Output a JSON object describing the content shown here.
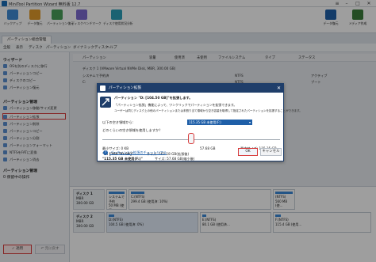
{
  "window": {
    "title": "MiniTool Partition Wizard 無料版 12.7"
  },
  "toolbar": {
    "items": [
      "バックアップ",
      "データ復元",
      "パーティション復元",
      "ディスクベンチマーク",
      "ディスク使用状況分析"
    ],
    "right_items": [
      "データ復元",
      "メディア作成"
    ]
  },
  "tabs": {
    "main": "パーティション総合管理"
  },
  "menu": [
    "全般",
    "表示",
    "ディスク",
    "パーティション",
    "ダイナミックディスク",
    "ヘルプ"
  ],
  "sidebar": {
    "wizard_header": "ウィザード",
    "wizard_items": [
      "OSを別のディスクに移行",
      "パーティションコピー",
      "ディスクのコピー",
      "パーティション復元"
    ],
    "partition_header": "パーティション管理",
    "partition_items": [
      "パーティション移動/サイズ変更",
      "パーティション拡張",
      "パーティション削除",
      "パーティションコピー",
      "パーティション分割",
      "パーティションフォーマット",
      "NTFSをFATに変換",
      "パーティション消去"
    ],
    "ops_header": "パーティション管理",
    "ops_status": "0 保留中の操作",
    "apply": "✓ 適用",
    "undo": "↶ 元に戻す"
  },
  "table": {
    "headers": [
      "パーティション",
      "容量",
      "使用済",
      "未使用",
      "ファイルシステム",
      "タイプ",
      "ステータス"
    ],
    "disk1": "ディスク 1 (VMware Virtual NVMe Disk, MBR, 300.00 GB)",
    "row1": {
      "name": "システムで予約済",
      "fs": "NTFS",
      "status": "アクティブ"
    },
    "row2": {
      "name": "C:",
      "fs": "NTFS",
      "status": "ブート"
    },
    "disk2": "ディスク 2 (VMware Virtual NVMe Disk, MBR, 300.00 GB)"
  },
  "diskmap": {
    "disk1_label": "ディスク 1",
    "disk1_type": "MBR",
    "disk1_size": "300.00 GB",
    "disk1_parts": [
      {
        "name": "システムで予約",
        "detail": "50 MB (使用…"
      },
      {
        "name": "C:(NTFS)",
        "detail": "299.4 GB (使用済: 10%)"
      },
      {
        "name": "(NTFS)",
        "detail": "560 MB (使…"
      }
    ],
    "disk2_label": "ディスク 2",
    "disk2_type": "MBR",
    "disk2_size": "300.00 GB",
    "disk2_parts": [
      {
        "name": "D:(NTFS)",
        "detail": "104.5 GB (使用済: 0%)"
      },
      {
        "name": "E:(NTFS)",
        "detail": "80.1 GB (使用済…"
      },
      {
        "name": "F:(NTFS)",
        "detail": "115.4 GB (使用…"
      }
    ]
  },
  "dialog": {
    "title": "パーティション拡張",
    "heading": "パーティション \"D: [104.50 GB]\"を拡張します。",
    "desc1": "「パーティション拡張」機能によって、ワンクリックでパーティションを拡張できます。",
    "desc2": "ユーザーは同じディスク上の他のパーティションまたは未割り当て領域から空き容量を取得して指定されたパーティションを拡張することができます。",
    "take_label": "以下の空き領域から:",
    "take_value": "115.35 GB 未使用(F:)",
    "howmuch": "どのくらいの空き領域を使用しますか？",
    "min_label": "最小サイズ: 0 KB",
    "max_label": "最大サイズ: 115.35 GB",
    "mid_value": "57.68 GB",
    "slider_fraction": 0.5,
    "line1": "\"D: [104.50 GB]\"",
    "line1_val": "サイズ: 162.18 GB(拡張後)",
    "line2": "\"115.35 GB 未使用(F:)\"",
    "line2_val": "サイズ: 57.68 GB(縮小後)",
    "help": "パーティション拡張のチュートリアル",
    "ok": "OK",
    "cancel": "キャンセル"
  }
}
